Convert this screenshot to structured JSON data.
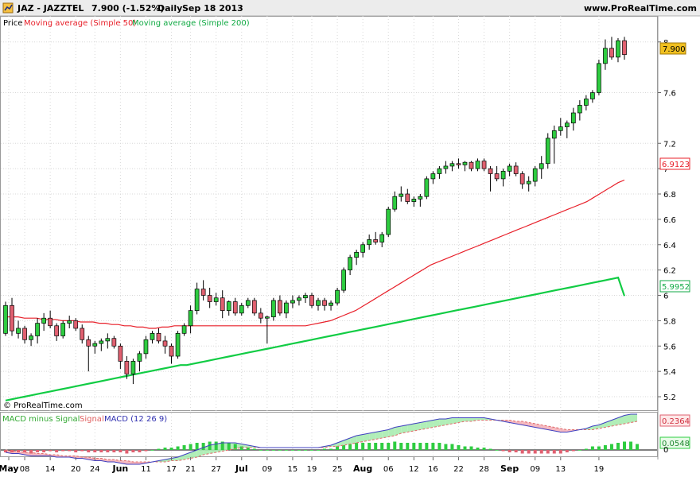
{
  "header": {
    "symbol": "JAZ - JAZZTEL",
    "price_change": "7.900 (-1.52%)",
    "period": "Daily",
    "date": "Sep 18 2013",
    "site": "www.ProRealTime.com",
    "watermark": "© ProRealTime.com"
  },
  "legend": {
    "price_label": "Price",
    "ma50_label": "Moving average (Simple 50)",
    "ma200_label": "Moving average (Simple 200)",
    "macd_hist_label": "MACD minus Signal",
    "signal_label": "Signal",
    "macd_label": "MACD (12 26 9)"
  },
  "colors": {
    "up": "#2ecc40",
    "down": "#e06070",
    "ma50": "#e8202a",
    "ma200": "#11cc44",
    "macd": "#4040c0",
    "signal": "#e07070",
    "grid": "#d8d8d8",
    "current_price_bg": "#f0c020"
  },
  "price_axis": {
    "ticks": [
      "8",
      "7.6",
      "7.2",
      "7",
      "6.8",
      "6.6",
      "6.4",
      "6.2",
      "6",
      "5.8",
      "5.6",
      "5.4",
      "5.2"
    ],
    "current_price": "7.900",
    "ma50_last": "6.9123",
    "ma200_last": "5.9952"
  },
  "macd_axis": {
    "signal_last": "0.2364",
    "hist_last": "0.0548",
    "zero": "0"
  },
  "x_axis": {
    "labels": [
      "May",
      "08",
      "14",
      "20",
      "24",
      "Jun",
      "11",
      "17",
      "21",
      "27",
      "Jul",
      "09",
      "15",
      "19",
      "25",
      "Aug",
      "06",
      "12",
      "16",
      "22",
      "28",
      "Sep",
      "09",
      "13",
      "19"
    ]
  },
  "chart_data": {
    "type": "candlestick",
    "period": "Daily",
    "x_range": [
      "2013-05-02",
      "2013-09-18"
    ],
    "ylim": [
      5.15,
      8.08
    ],
    "candles": [
      [
        5.7,
        5.95,
        5.68,
        5.92
      ],
      [
        5.92,
        5.98,
        5.68,
        5.72
      ],
      [
        5.7,
        5.8,
        5.66,
        5.74
      ],
      [
        5.74,
        5.76,
        5.62,
        5.65
      ],
      [
        5.65,
        5.7,
        5.6,
        5.68
      ],
      [
        5.68,
        5.82,
        5.62,
        5.78
      ],
      [
        5.78,
        5.86,
        5.72,
        5.82
      ],
      [
        5.82,
        5.88,
        5.74,
        5.76
      ],
      [
        5.76,
        5.78,
        5.64,
        5.68
      ],
      [
        5.68,
        5.8,
        5.66,
        5.78
      ],
      [
        5.78,
        5.84,
        5.74,
        5.8
      ],
      [
        5.8,
        5.82,
        5.72,
        5.74
      ],
      [
        5.74,
        5.77,
        5.62,
        5.65
      ],
      [
        5.65,
        5.68,
        5.4,
        5.6
      ],
      [
        5.6,
        5.64,
        5.54,
        5.62
      ],
      [
        5.62,
        5.66,
        5.56,
        5.64
      ],
      [
        5.64,
        5.7,
        5.58,
        5.66
      ],
      [
        5.66,
        5.68,
        5.58,
        5.6
      ],
      [
        5.6,
        5.62,
        5.42,
        5.48
      ],
      [
        5.48,
        5.52,
        5.34,
        5.38
      ],
      [
        5.38,
        5.5,
        5.3,
        5.48
      ],
      [
        5.48,
        5.56,
        5.4,
        5.54
      ],
      [
        5.54,
        5.68,
        5.5,
        5.65
      ],
      [
        5.65,
        5.72,
        5.62,
        5.7
      ],
      [
        5.7,
        5.74,
        5.62,
        5.64
      ],
      [
        5.64,
        5.68,
        5.54,
        5.6
      ],
      [
        5.6,
        5.62,
        5.46,
        5.52
      ],
      [
        5.52,
        5.72,
        5.5,
        5.7
      ],
      [
        5.7,
        5.78,
        5.68,
        5.76
      ],
      [
        5.76,
        5.92,
        5.7,
        5.88
      ],
      [
        5.88,
        6.1,
        5.85,
        6.05
      ],
      [
        6.05,
        6.12,
        5.96,
        6.0
      ],
      [
        6.0,
        6.06,
        5.9,
        5.95
      ],
      [
        5.95,
        6.02,
        5.92,
        5.98
      ],
      [
        5.98,
        6.04,
        5.82,
        5.88
      ],
      [
        5.88,
        5.96,
        5.84,
        5.95
      ],
      [
        5.95,
        5.98,
        5.84,
        5.86
      ],
      [
        5.86,
        5.94,
        5.84,
        5.92
      ],
      [
        5.92,
        5.98,
        5.9,
        5.96
      ],
      [
        5.96,
        5.98,
        5.84,
        5.86
      ],
      [
        5.86,
        5.9,
        5.78,
        5.82
      ],
      [
        5.82,
        5.84,
        5.62,
        5.83
      ],
      [
        5.83,
        5.98,
        5.8,
        5.96
      ],
      [
        5.96,
        6.0,
        5.84,
        5.86
      ],
      [
        5.86,
        5.96,
        5.82,
        5.94
      ],
      [
        5.94,
        6.0,
        5.9,
        5.96
      ],
      [
        5.96,
        6.0,
        5.92,
        5.98
      ],
      [
        5.98,
        6.02,
        5.94,
        6.0
      ],
      [
        6.0,
        6.02,
        5.9,
        5.92
      ],
      [
        5.92,
        5.98,
        5.88,
        5.96
      ],
      [
        5.96,
        5.98,
        5.88,
        5.92
      ],
      [
        5.92,
        5.96,
        5.88,
        5.94
      ],
      [
        5.94,
        6.06,
        5.92,
        6.04
      ],
      [
        6.04,
        6.22,
        6.02,
        6.2
      ],
      [
        6.2,
        6.32,
        6.16,
        6.3
      ],
      [
        6.3,
        6.36,
        6.24,
        6.34
      ],
      [
        6.34,
        6.42,
        6.3,
        6.4
      ],
      [
        6.4,
        6.48,
        6.36,
        6.44
      ],
      [
        6.44,
        6.5,
        6.4,
        6.42
      ],
      [
        6.42,
        6.5,
        6.38,
        6.48
      ],
      [
        6.48,
        6.7,
        6.46,
        6.68
      ],
      [
        6.68,
        6.82,
        6.66,
        6.78
      ],
      [
        6.78,
        6.86,
        6.74,
        6.8
      ],
      [
        6.8,
        6.84,
        6.72,
        6.74
      ],
      [
        6.74,
        6.78,
        6.7,
        6.76
      ],
      [
        6.76,
        6.8,
        6.7,
        6.78
      ],
      [
        6.78,
        6.94,
        6.76,
        6.92
      ],
      [
        6.92,
        6.98,
        6.88,
        6.96
      ],
      [
        6.96,
        7.02,
        6.92,
        7.0
      ],
      [
        7.0,
        7.06,
        6.96,
        7.02
      ],
      [
        7.02,
        7.06,
        6.98,
        7.04
      ],
      [
        7.04,
        7.08,
        7.0,
        7.03
      ],
      [
        7.03,
        7.06,
        6.98,
        7.05
      ],
      [
        7.05,
        7.06,
        6.98,
        7.0
      ],
      [
        7.0,
        7.08,
        6.98,
        7.06
      ],
      [
        7.06,
        7.08,
        6.98,
        7.0
      ],
      [
        7.0,
        7.02,
        6.82,
        6.96
      ],
      [
        6.96,
        7.02,
        6.9,
        6.92
      ],
      [
        6.92,
        7.0,
        6.86,
        6.98
      ],
      [
        6.98,
        7.04,
        6.94,
        7.02
      ],
      [
        7.02,
        7.05,
        6.94,
        6.96
      ],
      [
        6.96,
        6.98,
        6.84,
        6.88
      ],
      [
        6.88,
        6.94,
        6.82,
        6.9
      ],
      [
        6.9,
        7.02,
        6.86,
        7.0
      ],
      [
        7.0,
        7.1,
        6.92,
        7.04
      ],
      [
        7.04,
        7.28,
        7.0,
        7.24
      ],
      [
        7.24,
        7.34,
        7.04,
        7.3
      ],
      [
        7.3,
        7.4,
        7.26,
        7.33
      ],
      [
        7.33,
        7.38,
        7.24,
        7.36
      ],
      [
        7.36,
        7.48,
        7.3,
        7.44
      ],
      [
        7.44,
        7.54,
        7.38,
        7.5
      ],
      [
        7.5,
        7.58,
        7.46,
        7.55
      ],
      [
        7.55,
        7.62,
        7.52,
        7.6
      ],
      [
        7.6,
        7.86,
        7.58,
        7.83
      ],
      [
        7.83,
        8.02,
        7.78,
        7.95
      ],
      [
        7.95,
        8.04,
        7.86,
        7.88
      ],
      [
        7.88,
        8.03,
        7.84,
        8.01
      ],
      [
        8.01,
        8.04,
        7.86,
        7.9
      ]
    ],
    "ma50": {
      "name": "Moving average (Simple 50)",
      "last": 6.9123,
      "values": [
        5.83,
        5.83,
        5.83,
        5.82,
        5.82,
        5.82,
        5.81,
        5.81,
        5.81,
        5.8,
        5.8,
        5.8,
        5.79,
        5.79,
        5.79,
        5.78,
        5.78,
        5.77,
        5.77,
        5.76,
        5.76,
        5.75,
        5.75,
        5.74,
        5.74,
        5.75,
        5.75,
        5.76,
        5.76,
        5.76,
        5.76,
        5.76,
        5.76,
        5.76,
        5.76,
        5.76,
        5.76,
        5.76,
        5.76,
        5.76,
        5.76,
        5.76,
        5.76,
        5.76,
        5.76,
        5.76,
        5.76,
        5.76,
        5.76,
        5.77,
        5.78,
        5.79,
        5.8,
        5.82,
        5.84,
        5.86,
        5.88,
        5.91,
        5.94,
        5.97,
        6.0,
        6.03,
        6.06,
        6.09,
        6.12,
        6.15,
        6.18,
        6.21,
        6.24,
        6.26,
        6.28,
        6.3,
        6.32,
        6.34,
        6.36,
        6.38,
        6.4,
        6.42,
        6.44,
        6.46,
        6.48,
        6.5,
        6.52,
        6.54,
        6.56,
        6.58,
        6.6,
        6.62,
        6.64,
        6.66,
        6.68,
        6.7,
        6.72,
        6.74,
        6.77,
        6.8,
        6.83,
        6.86,
        6.89,
        6.91
      ]
    },
    "ma200": {
      "name": "Moving average (Simple 200)",
      "last": 5.9952,
      "values": [
        5.17,
        5.18,
        5.19,
        5.2,
        5.21,
        5.22,
        5.23,
        5.24,
        5.25,
        5.26,
        5.27,
        5.28,
        5.29,
        5.3,
        5.31,
        5.32,
        5.33,
        5.34,
        5.35,
        5.36,
        5.37,
        5.38,
        5.39,
        5.4,
        5.41,
        5.42,
        5.43,
        5.44,
        5.45,
        5.45,
        5.46,
        5.47,
        5.48,
        5.49,
        5.5,
        5.51,
        5.52,
        5.53,
        5.54,
        5.55,
        5.56,
        5.57,
        5.58,
        5.59,
        5.6,
        5.61,
        5.62,
        5.63,
        5.64,
        5.65,
        5.66,
        5.67,
        5.68,
        5.69,
        5.7,
        5.71,
        5.72,
        5.73,
        5.74,
        5.75,
        5.76,
        5.77,
        5.78,
        5.79,
        5.8,
        5.81,
        5.82,
        5.83,
        5.84,
        5.85,
        5.86,
        5.87,
        5.88,
        5.89,
        5.9,
        5.91,
        5.92,
        5.93,
        5.94,
        5.95,
        5.96,
        5.97,
        5.98,
        5.99,
        6.0,
        6.01,
        6.02,
        6.03,
        6.04,
        6.05,
        6.06,
        6.07,
        6.08,
        6.09,
        6.1,
        6.11,
        6.12,
        6.13,
        6.14,
        5.9952
      ]
    },
    "macd_panel": {
      "title": "MACD (12 26 9)",
      "macd_last": 0.2364,
      "hist_last": 0.0548,
      "macd": [
        -0.02,
        -0.03,
        -0.03,
        -0.04,
        -0.05,
        -0.05,
        -0.05,
        -0.05,
        -0.06,
        -0.06,
        -0.06,
        -0.07,
        -0.07,
        -0.08,
        -0.09,
        -0.09,
        -0.1,
        -0.1,
        -0.11,
        -0.12,
        -0.12,
        -0.12,
        -0.11,
        -0.1,
        -0.09,
        -0.08,
        -0.07,
        -0.06,
        -0.04,
        -0.02,
        0.0,
        0.02,
        0.04,
        0.05,
        0.06,
        0.06,
        0.06,
        0.05,
        0.04,
        0.03,
        0.02,
        0.02,
        0.02,
        0.02,
        0.02,
        0.02,
        0.02,
        0.02,
        0.02,
        0.02,
        0.03,
        0.04,
        0.06,
        0.08,
        0.1,
        0.12,
        0.13,
        0.14,
        0.15,
        0.16,
        0.17,
        0.19,
        0.2,
        0.21,
        0.22,
        0.23,
        0.24,
        0.25,
        0.26,
        0.26,
        0.27,
        0.27,
        0.27,
        0.27,
        0.27,
        0.27,
        0.26,
        0.25,
        0.24,
        0.23,
        0.22,
        0.21,
        0.2,
        0.19,
        0.18,
        0.17,
        0.16,
        0.15,
        0.15,
        0.16,
        0.17,
        0.18,
        0.2,
        0.21,
        0.23,
        0.25,
        0.27,
        0.29,
        0.3,
        0.3
      ],
      "signal": [
        0.0,
        -0.01,
        -0.01,
        -0.02,
        -0.02,
        -0.03,
        -0.03,
        -0.04,
        -0.04,
        -0.05,
        -0.05,
        -0.05,
        -0.06,
        -0.06,
        -0.07,
        -0.07,
        -0.08,
        -0.08,
        -0.09,
        -0.09,
        -0.1,
        -0.1,
        -0.1,
        -0.1,
        -0.1,
        -0.1,
        -0.09,
        -0.09,
        -0.08,
        -0.07,
        -0.06,
        -0.04,
        -0.03,
        -0.02,
        -0.01,
        0.0,
        0.01,
        0.02,
        0.02,
        0.02,
        0.02,
        0.02,
        0.02,
        0.02,
        0.02,
        0.02,
        0.02,
        0.02,
        0.02,
        0.02,
        0.02,
        0.03,
        0.03,
        0.04,
        0.05,
        0.06,
        0.07,
        0.08,
        0.09,
        0.1,
        0.11,
        0.12,
        0.14,
        0.15,
        0.16,
        0.17,
        0.18,
        0.19,
        0.2,
        0.21,
        0.22,
        0.23,
        0.24,
        0.24,
        0.25,
        0.25,
        0.25,
        0.25,
        0.25,
        0.25,
        0.24,
        0.24,
        0.23,
        0.22,
        0.21,
        0.2,
        0.19,
        0.18,
        0.17,
        0.17,
        0.17,
        0.17,
        0.17,
        0.18,
        0.19,
        0.2,
        0.21,
        0.22,
        0.23,
        0.24
      ],
      "histogram": [
        -0.02,
        -0.02,
        -0.02,
        -0.02,
        -0.03,
        -0.02,
        -0.02,
        -0.01,
        -0.02,
        -0.01,
        -0.01,
        -0.02,
        -0.01,
        -0.02,
        -0.02,
        -0.02,
        -0.02,
        -0.02,
        -0.02,
        -0.03,
        -0.02,
        -0.02,
        -0.01,
        0.0,
        0.01,
        0.02,
        0.02,
        0.03,
        0.04,
        0.05,
        0.06,
        0.06,
        0.07,
        0.07,
        0.07,
        0.06,
        0.05,
        0.03,
        0.02,
        0.01,
        0.0,
        0.0,
        0.0,
        0.0,
        0.0,
        0.0,
        0.0,
        0.0,
        0.0,
        0.0,
        0.01,
        0.01,
        0.03,
        0.04,
        0.05,
        0.06,
        0.06,
        0.06,
        0.06,
        0.06,
        0.06,
        0.07,
        0.06,
        0.06,
        0.06,
        0.06,
        0.06,
        0.06,
        0.06,
        0.05,
        0.05,
        0.04,
        0.03,
        0.03,
        0.02,
        0.02,
        0.01,
        0.0,
        -0.01,
        -0.02,
        -0.02,
        -0.03,
        -0.03,
        -0.03,
        -0.03,
        -0.03,
        -0.03,
        -0.03,
        -0.02,
        -0.01,
        0.0,
        0.01,
        0.03,
        0.03,
        0.04,
        0.05,
        0.06,
        0.07,
        0.07,
        0.05
      ]
    }
  }
}
